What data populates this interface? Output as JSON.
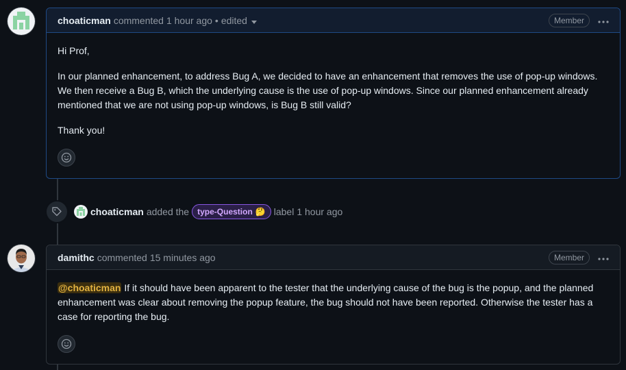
{
  "comment1": {
    "author": "choaticman",
    "action": "commented",
    "time": "1 hour ago",
    "edited": "edited",
    "badge": "Member",
    "paragraphs": [
      "Hi Prof,",
      "In our planned enhancement, to address Bug A, we decided to have an enhancement that removes the use of pop-up windows. We then receive a Bug B, which the underlying cause is the use of pop-up windows. Since our planned enhancement already mentioned that we are not using pop-up windows, is Bug B still valid?",
      "Thank you!"
    ]
  },
  "event": {
    "actor": "choaticman",
    "text_before": "added the",
    "label": "type-Question",
    "label_emoji": "🤔",
    "text_after": "label",
    "time": "1 hour ago"
  },
  "comment2": {
    "author": "damithc",
    "action": "commented",
    "time": "15 minutes ago",
    "badge": "Member",
    "mention": "@choaticman",
    "body": "If it should have been apparent to the tester that the underlying cause of the bug is the popup, and the planned enhancement was clear about removing the popup feature, the bug should not have been reported. Otherwise the tester has a case for reporting the bug."
  },
  "icons": {
    "kebab": "…",
    "caret": "caret-down-icon",
    "reaction": "smiley-icon",
    "tag": "tag-icon"
  },
  "colors": {
    "background": "#0d1117",
    "accent_border": "#1f4a85",
    "label_color": "#d2a8ff",
    "mention_color": "#e3b341"
  }
}
